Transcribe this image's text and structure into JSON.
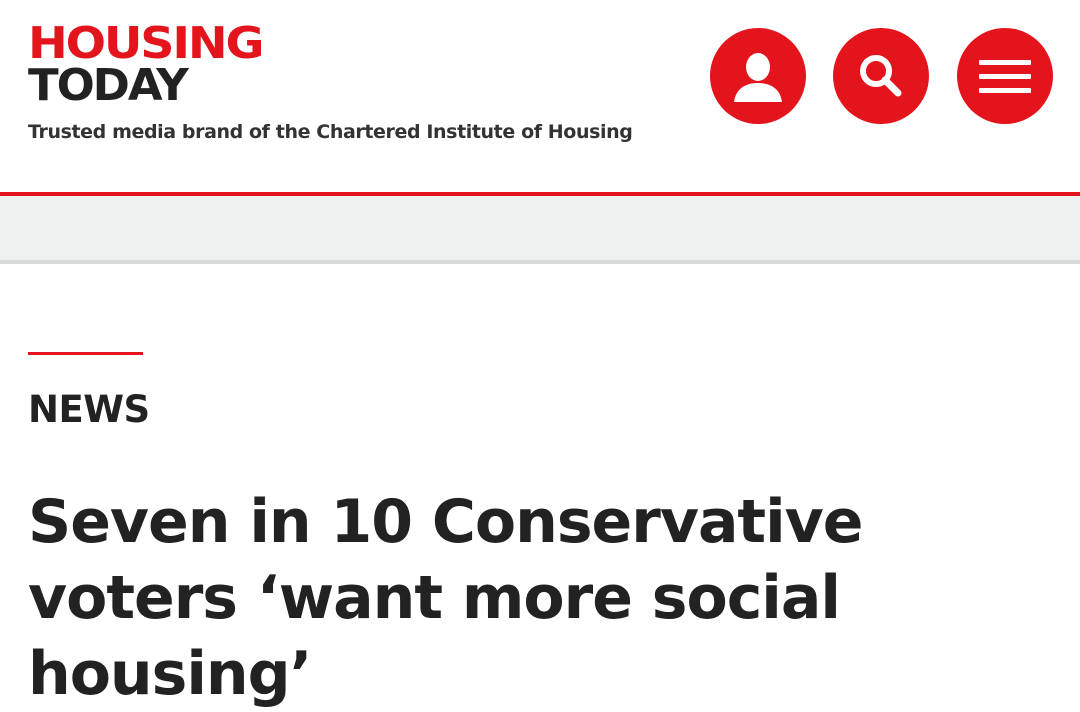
{
  "brand": {
    "logo_line1": "HOUSING",
    "logo_line2": "TODAY",
    "tagline": "Trusted media brand of the Chartered Institute of Housing",
    "accent_color": "#e3141b",
    "dark_color": "#222222"
  },
  "header": {
    "icons": [
      "user-icon",
      "search-icon",
      "menu-icon"
    ]
  },
  "article": {
    "section": "NEWS",
    "headline": "Seven in 10 Conservative voters ‘want more social housing’"
  }
}
